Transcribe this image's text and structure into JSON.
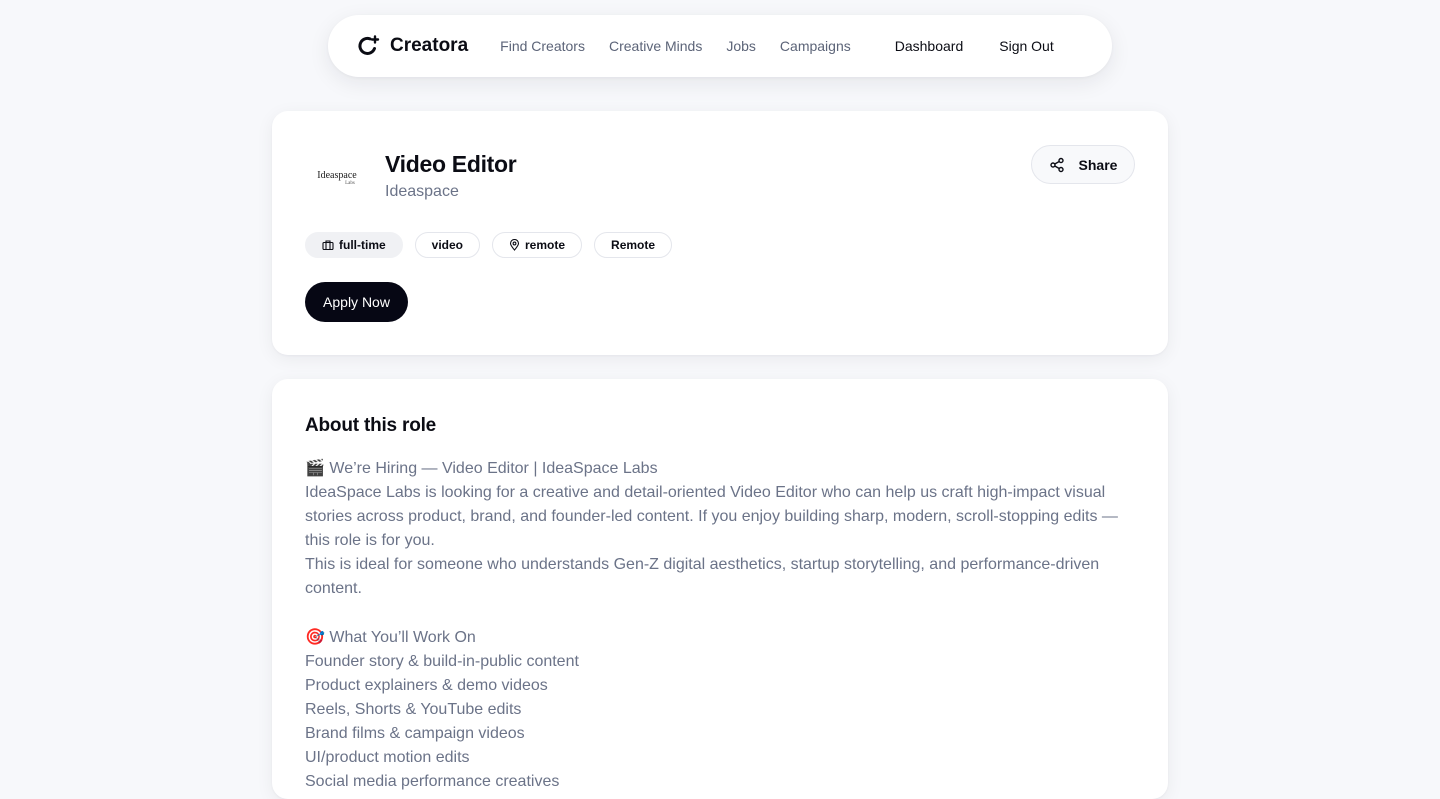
{
  "nav": {
    "brand": "Creatora",
    "links": [
      "Find Creators",
      "Creative Minds",
      "Jobs",
      "Campaigns"
    ],
    "dashboard": "Dashboard",
    "sign_out": "Sign Out"
  },
  "job": {
    "logo_text": "Ideaspace",
    "logo_sub": "Labs",
    "title": "Video Editor",
    "company": "Ideaspace",
    "share_label": "Share",
    "tags": [
      "full-time",
      "video",
      "remote",
      "Remote"
    ],
    "apply_label": "Apply Now"
  },
  "about": {
    "heading": "About this role",
    "hiring_emoji": "🎬",
    "hiring_line": "We’re Hiring — Video Editor | IdeaSpace Labs",
    "para1": "IdeaSpace Labs is looking for a creative and detail-oriented Video Editor who can help us craft high-impact visual stories across product, brand, and founder-led content. If you enjoy building sharp, modern, scroll-stopping edits — this role is for you.",
    "para2": "This is ideal for someone who understands Gen-Z digital aesthetics, startup storytelling, and performance-driven content.",
    "work_emoji": "🎯",
    "work_heading": "What You’ll Work On",
    "work_items": [
      "Founder story & build-in-public content",
      "Product explainers & demo videos",
      "Reels, Shorts & YouTube edits",
      "Brand films & campaign videos",
      "UI/product motion edits",
      "Social media performance creatives"
    ]
  },
  "colors": {
    "background": "#f7f8fb",
    "primary": "#060714",
    "muted_text": "#6b7388"
  }
}
